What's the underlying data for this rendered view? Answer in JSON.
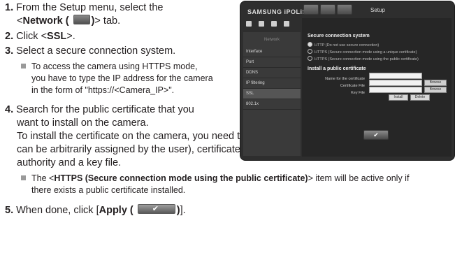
{
  "steps": {
    "s1": {
      "num": "1.",
      "text_a": "From the Setup menu, select the",
      "text_b_pre": "<",
      "text_b_bold": "Network (",
      "text_b_bold2": ")",
      "text_b_post": "> tab."
    },
    "s2": {
      "num": "2.",
      "pre": "Click <",
      "bold": "SSL",
      "post": ">."
    },
    "s3": {
      "num": "3.",
      "text": "Select a secure connection system."
    },
    "s3_note": {
      "line1": "To access the camera using HTTPS mode,",
      "line2": "you have to type the IP address for the camera",
      "line3": "in the form of \"https://<Camera_IP>\"."
    },
    "s4": {
      "num": "4.",
      "line1": "Search for the public certificate that you",
      "line2": "want to install on the camera."
    },
    "s4_para": {
      "line1": "To install the certificate on the camera, you need to provide a certificate name (it",
      "line2": "can be arbitrarily assigned by the user), certificate file issued from the certification",
      "line3": "authority and a key file."
    },
    "s4_note": {
      "pre": "The <",
      "bold": "HTTPS (Secure connection mode using the public certificate)",
      "post": "> item will be active only if",
      "line2": "there exists a public certificate installed."
    },
    "s5": {
      "num": "5.",
      "pre": "When done, click [",
      "bold": "Apply (",
      "bold2": ")",
      "post": "]."
    }
  },
  "screenshot": {
    "logo": "SAMSUNG iPOLiS",
    "top_label": "Setup",
    "sidebar_header": "Network",
    "sidebar_items": [
      "Interface",
      "Port",
      "DDNS",
      "IP filtering",
      "SSL",
      "802.1x"
    ],
    "active_item": "SSL",
    "section1_title": "Secure connection system",
    "options": [
      "HTTP (Do not use secure connection)",
      "HTTPS (Secure connection mode using a unique certificate)",
      "HTTPS (Secure connection mode using the public certificate)"
    ],
    "section2_title": "Install a public certificate",
    "fields": [
      {
        "label": "Name for the certificate",
        "button": ""
      },
      {
        "label": "Certificate File",
        "button": "Browse"
      },
      {
        "label": "Key File",
        "button": "Browse"
      }
    ],
    "install_button": "Install",
    "delete_button": "Delete",
    "apply_symbol": "✔"
  }
}
